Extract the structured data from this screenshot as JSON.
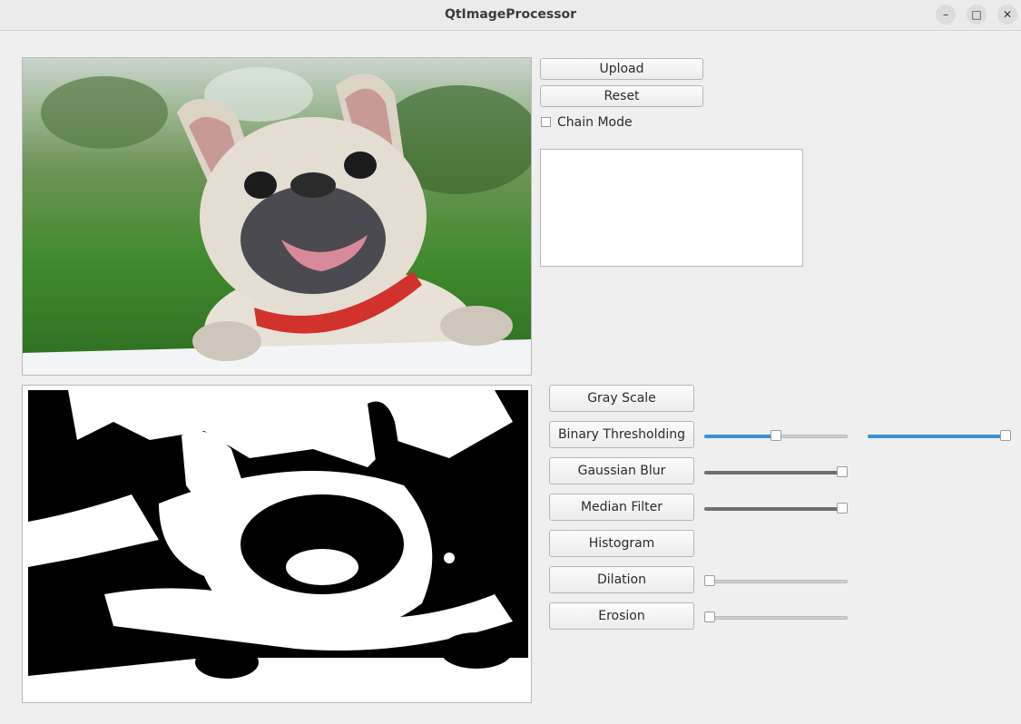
{
  "window": {
    "title": "QtImageProcessor",
    "controls": [
      "minimize",
      "maximize",
      "close"
    ]
  },
  "images": {
    "original": "French bulldog with red collar, paws on white ledge, green blurred background",
    "processed": "Binary thresholded black and white version of the bulldog photo"
  },
  "top_controls": {
    "upload_label": "Upload",
    "reset_label": "Reset",
    "chain_mode_label": "Chain Mode",
    "chain_mode_checked": false
  },
  "operations": {
    "gray_scale": "Gray Scale",
    "binary_thresholding": "Binary Thresholding",
    "gaussian_blur": "Gaussian Blur",
    "median_filter": "Median Filter",
    "histogram": "Histogram",
    "dilation": "Dilation",
    "erosion": "Erosion"
  },
  "sliders": {
    "binary_threshold": 0.5,
    "binary_max": 1.0,
    "gaussian_blur": 1.0,
    "median_filter": 1.0,
    "dilation": 0.0,
    "erosion": 0.0
  },
  "colors": {
    "accent": "#3b92d8",
    "dark_fill": "#6e6e6e"
  }
}
